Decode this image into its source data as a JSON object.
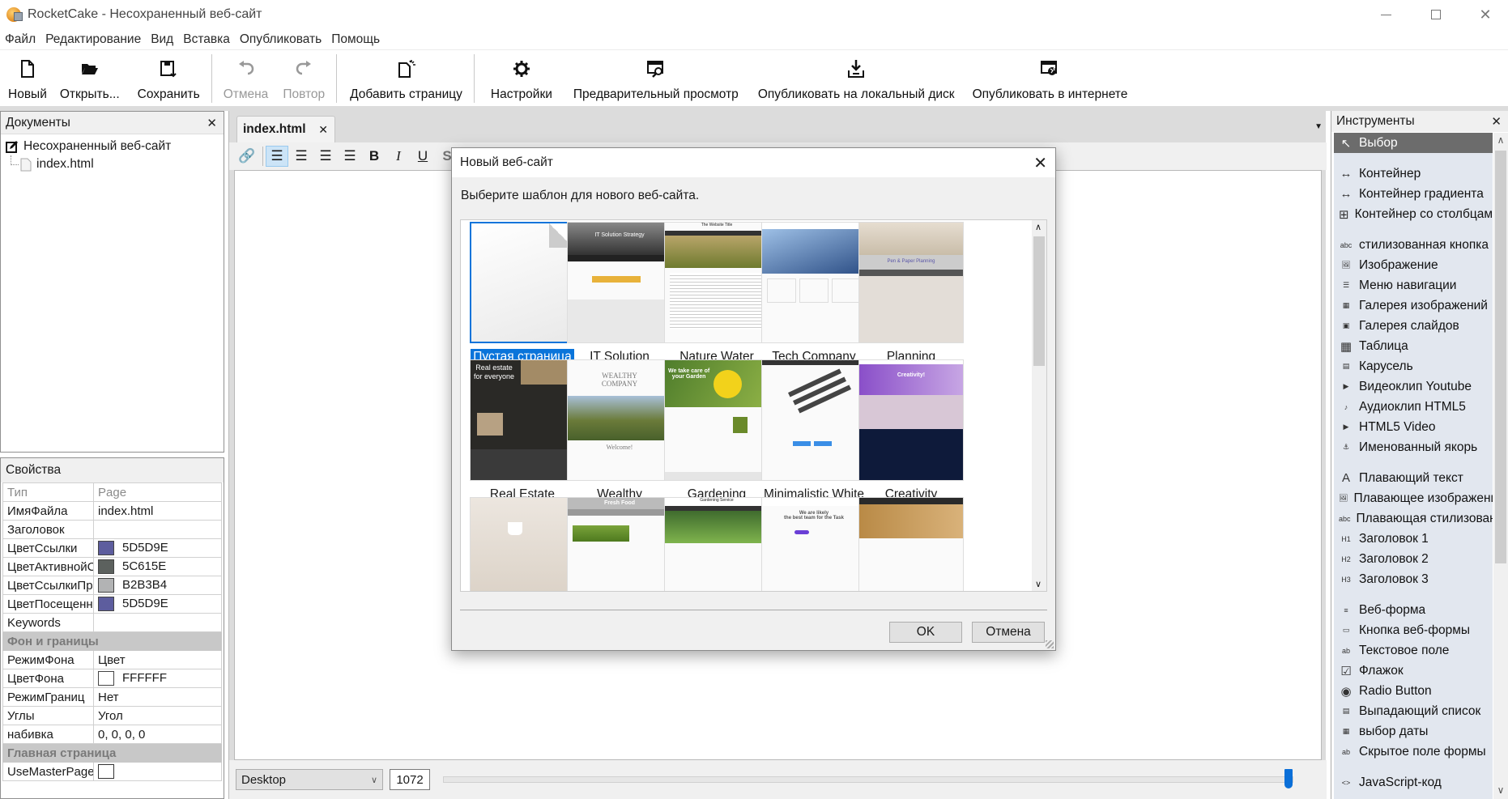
{
  "window": {
    "title": "RocketCake - Несохраненный веб-сайт",
    "controls": [
      "minimize-icon",
      "maximize-icon",
      "close-icon"
    ]
  },
  "menu": [
    "Файл",
    "Редактирование",
    "Вид",
    "Вставка",
    "Опубликовать",
    "Помощь"
  ],
  "toolbar": {
    "new": "Новый",
    "open": "Открыть...",
    "save": "Сохранить",
    "undo": "Отмена",
    "redo": "Повтор",
    "add_page": "Добавить страницу",
    "settings": "Настройки",
    "preview": "Предварительный просмотр",
    "publish_local": "Опубликовать на локальный диск",
    "publish_web": "Опубликовать в интернете"
  },
  "documents": {
    "title": "Документы",
    "tree": {
      "site": "Несохраненный веб-сайт",
      "page": "index.html"
    }
  },
  "properties": {
    "title": "Свойства",
    "header": {
      "key": "Тип",
      "value": "Page"
    },
    "rows": [
      {
        "key": "ИмяФайла",
        "value": "index.html"
      },
      {
        "key": "Заголовок",
        "value": ""
      },
      {
        "key": "ЦветСсылки",
        "value": "5D5D9E",
        "color": "#5D5D9E"
      },
      {
        "key": "ЦветАктивнойС",
        "value": "5C615E",
        "color": "#5C615E"
      },
      {
        "key": "ЦветСсылкиПр",
        "value": "B2B3B4",
        "color": "#B2B3B4"
      },
      {
        "key": "ЦветПосещенн",
        "value": "5D5D9E",
        "color": "#5D5D9E"
      },
      {
        "key": "Keywords",
        "value": ""
      }
    ],
    "group_background": "Фон и границы",
    "rows2": [
      {
        "key": "РежимФона",
        "value": "Цвет"
      },
      {
        "key": "ЦветФона",
        "value": "FFFFFF",
        "color": "#FFFFFF"
      },
      {
        "key": "РежимГраниц",
        "value": "Нет"
      },
      {
        "key": "Углы",
        "value": "Угол"
      },
      {
        "key": "набивка",
        "value": "0, 0, 0, 0"
      }
    ],
    "group_master": "Главная страница",
    "rows3": [
      {
        "key": "UseMasterPage",
        "checked": false
      }
    ]
  },
  "editor": {
    "tab": "index.html",
    "device_select": "Desktop",
    "width_value": "1072",
    "width_slider_fraction": 1.0
  },
  "tools": {
    "title": "Инструменты",
    "groups": [
      [
        {
          "label": "Выбор",
          "icon": "cursor-icon",
          "selected": true
        }
      ],
      [
        {
          "label": "Контейнер",
          "icon": "container-icon"
        },
        {
          "label": "Контейнер градиента",
          "icon": "gradient-container-icon"
        },
        {
          "label": "Контейнер со столбцами",
          "icon": "column-container-icon"
        }
      ],
      [
        {
          "label": "стилизованная кнопка",
          "icon": "styled-button-icon"
        },
        {
          "label": "Изображение",
          "icon": "image-icon"
        },
        {
          "label": "Меню навигации",
          "icon": "nav-menu-icon"
        },
        {
          "label": "Галерея изображений",
          "icon": "image-gallery-icon"
        },
        {
          "label": "Галерея слайдов",
          "icon": "slide-gallery-icon"
        },
        {
          "label": "Таблица",
          "icon": "table-icon"
        },
        {
          "label": "Карусель",
          "icon": "carousel-icon"
        },
        {
          "label": "Видеоклип Youtube",
          "icon": "youtube-icon"
        },
        {
          "label": "Аудиоклип HTML5",
          "icon": "audio-icon"
        },
        {
          "label": "HTML5 Video",
          "icon": "video-icon"
        },
        {
          "label": "Именованный якорь",
          "icon": "anchor-icon"
        }
      ],
      [
        {
          "label": "Плавающий текст",
          "icon": "floating-text-icon"
        },
        {
          "label": "Плавающее изображение",
          "icon": "floating-image-icon"
        },
        {
          "label": "Плавающая стилизованная кнопка",
          "icon": "floating-button-icon"
        },
        {
          "label": "Заголовок 1",
          "icon": "h1-icon"
        },
        {
          "label": "Заголовок 2",
          "icon": "h2-icon"
        },
        {
          "label": "Заголовок 3",
          "icon": "h3-icon"
        }
      ],
      [
        {
          "label": "Веб-форма",
          "icon": "web-form-icon"
        },
        {
          "label": "Кнопка веб-формы",
          "icon": "form-button-icon"
        },
        {
          "label": "Текстовое поле",
          "icon": "text-field-icon"
        },
        {
          "label": "Флажок",
          "icon": "checkbox-icon"
        },
        {
          "label": "Radio Button",
          "icon": "radio-icon"
        },
        {
          "label": "Выпадающий список",
          "icon": "dropdown-icon"
        },
        {
          "label": "выбор даты",
          "icon": "date-picker-icon"
        },
        {
          "label": "Скрытое поле формы",
          "icon": "hidden-field-icon"
        }
      ],
      [
        {
          "label": "JavaScript-код",
          "icon": "javascript-icon"
        }
      ]
    ]
  },
  "dialog": {
    "title": "Новый веб-сайт",
    "prompt": "Выберите шаблон для нового веб-сайта.",
    "templates": [
      {
        "label": "Пустая страница",
        "selected": true,
        "theme": "blank"
      },
      {
        "label": "IT Solution Strategy",
        "theme": "it"
      },
      {
        "label": "Nature Water",
        "theme": "nature"
      },
      {
        "label": "Tech Company",
        "theme": "tech"
      },
      {
        "label": "Planning",
        "theme": "planning"
      },
      {
        "label": "Real Estate",
        "theme": "realestate"
      },
      {
        "label": "Wealthy Company",
        "theme": "wealthy"
      },
      {
        "label": "Gardening",
        "theme": "gardening"
      },
      {
        "label": "Minimalistic White",
        "theme": "minimal"
      },
      {
        "label": "Creativity",
        "theme": "creativity"
      },
      {
        "label": "",
        "theme": "cafe"
      },
      {
        "label": "",
        "theme": "freshfood"
      },
      {
        "label": "",
        "theme": "gardenservice"
      },
      {
        "label": "",
        "theme": "team"
      },
      {
        "label": "",
        "theme": "hotel"
      }
    ],
    "ok": "OK",
    "cancel": "Отмена"
  },
  "colors": {
    "accent": "#0A74DA",
    "tool_list_bg": "#E2E7EF",
    "selected_tool_bg": "#6C6C6C"
  }
}
